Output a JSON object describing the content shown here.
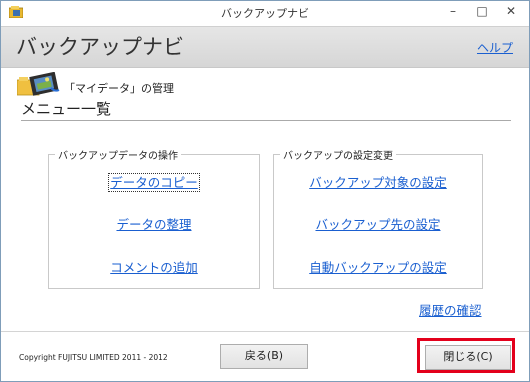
{
  "window": {
    "title": "バックアップナビ",
    "minimize_glyph": "–",
    "maximize_glyph": "□",
    "close_glyph": "✕"
  },
  "header": {
    "title": "バックアップナビ",
    "help_label": "ヘルプ"
  },
  "section": {
    "manage_label": "「マイデータ」の管理",
    "menu_title": "メニュー一覧"
  },
  "groups": {
    "left": {
      "legend": "バックアップデータの操作",
      "links": [
        "データのコピー",
        "データの整理",
        "コメントの追加"
      ]
    },
    "right": {
      "legend": "バックアップの設定変更",
      "links": [
        "バックアップ対象の設定",
        "バックアップ先の設定",
        "自動バックアップの設定"
      ]
    }
  },
  "history_label": "履歴の確認",
  "footer": {
    "copyright": "Copyright FUJITSU LIMITED 2011 - 2012",
    "back_label": "戻る(B)",
    "close_label": "閉じる(C)"
  },
  "colors": {
    "link": "#1a5fd0",
    "highlight": "#e3001b"
  },
  "icons": {
    "title": "app-icon",
    "manage": "folder-film-icon"
  }
}
